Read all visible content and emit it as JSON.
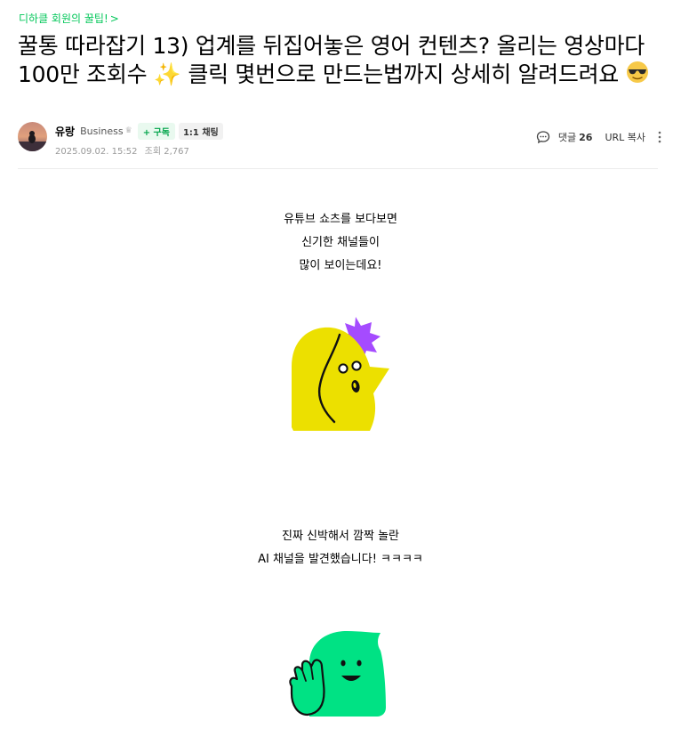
{
  "breadcrumb": {
    "category": "디하클 회원의 꿀팁!",
    "chevron": ">"
  },
  "post": {
    "title": "꿀통 따라잡기 13) 업계를 뒤집어놓은 영어 컨텐츠? 올리는 영상마다 100만 조회수 ✨ 클릭 몇번으로 만드는법까지 상세히 알려드려요",
    "title_emoji": "😎-icon"
  },
  "author": {
    "name": "유랑",
    "tag": "Business",
    "crown": "♛",
    "subscribe_label": "+ 구독",
    "chat_label": "1:1 채팅",
    "date": "2025.09.02. 15:52",
    "views": "조회 2,767"
  },
  "actions": {
    "comments_label": "댓글",
    "comments_count": "26",
    "url_copy": "URL 복사"
  },
  "body": {
    "paragraph1": [
      "유튜브 쇼츠를 보다보면",
      "신기한 채널들이",
      "많이 보이는데요!"
    ],
    "paragraph2": [
      "진짜 신박해서 깜짝 놀란",
      "AI 채널을 발견했습니다! ㅋㅋㅋㅋ"
    ]
  },
  "colors": {
    "accent": "#03c75a",
    "yellow_mascot": "#ece000",
    "purple_star": "#a54bff",
    "green_mascot": "#00e284"
  }
}
